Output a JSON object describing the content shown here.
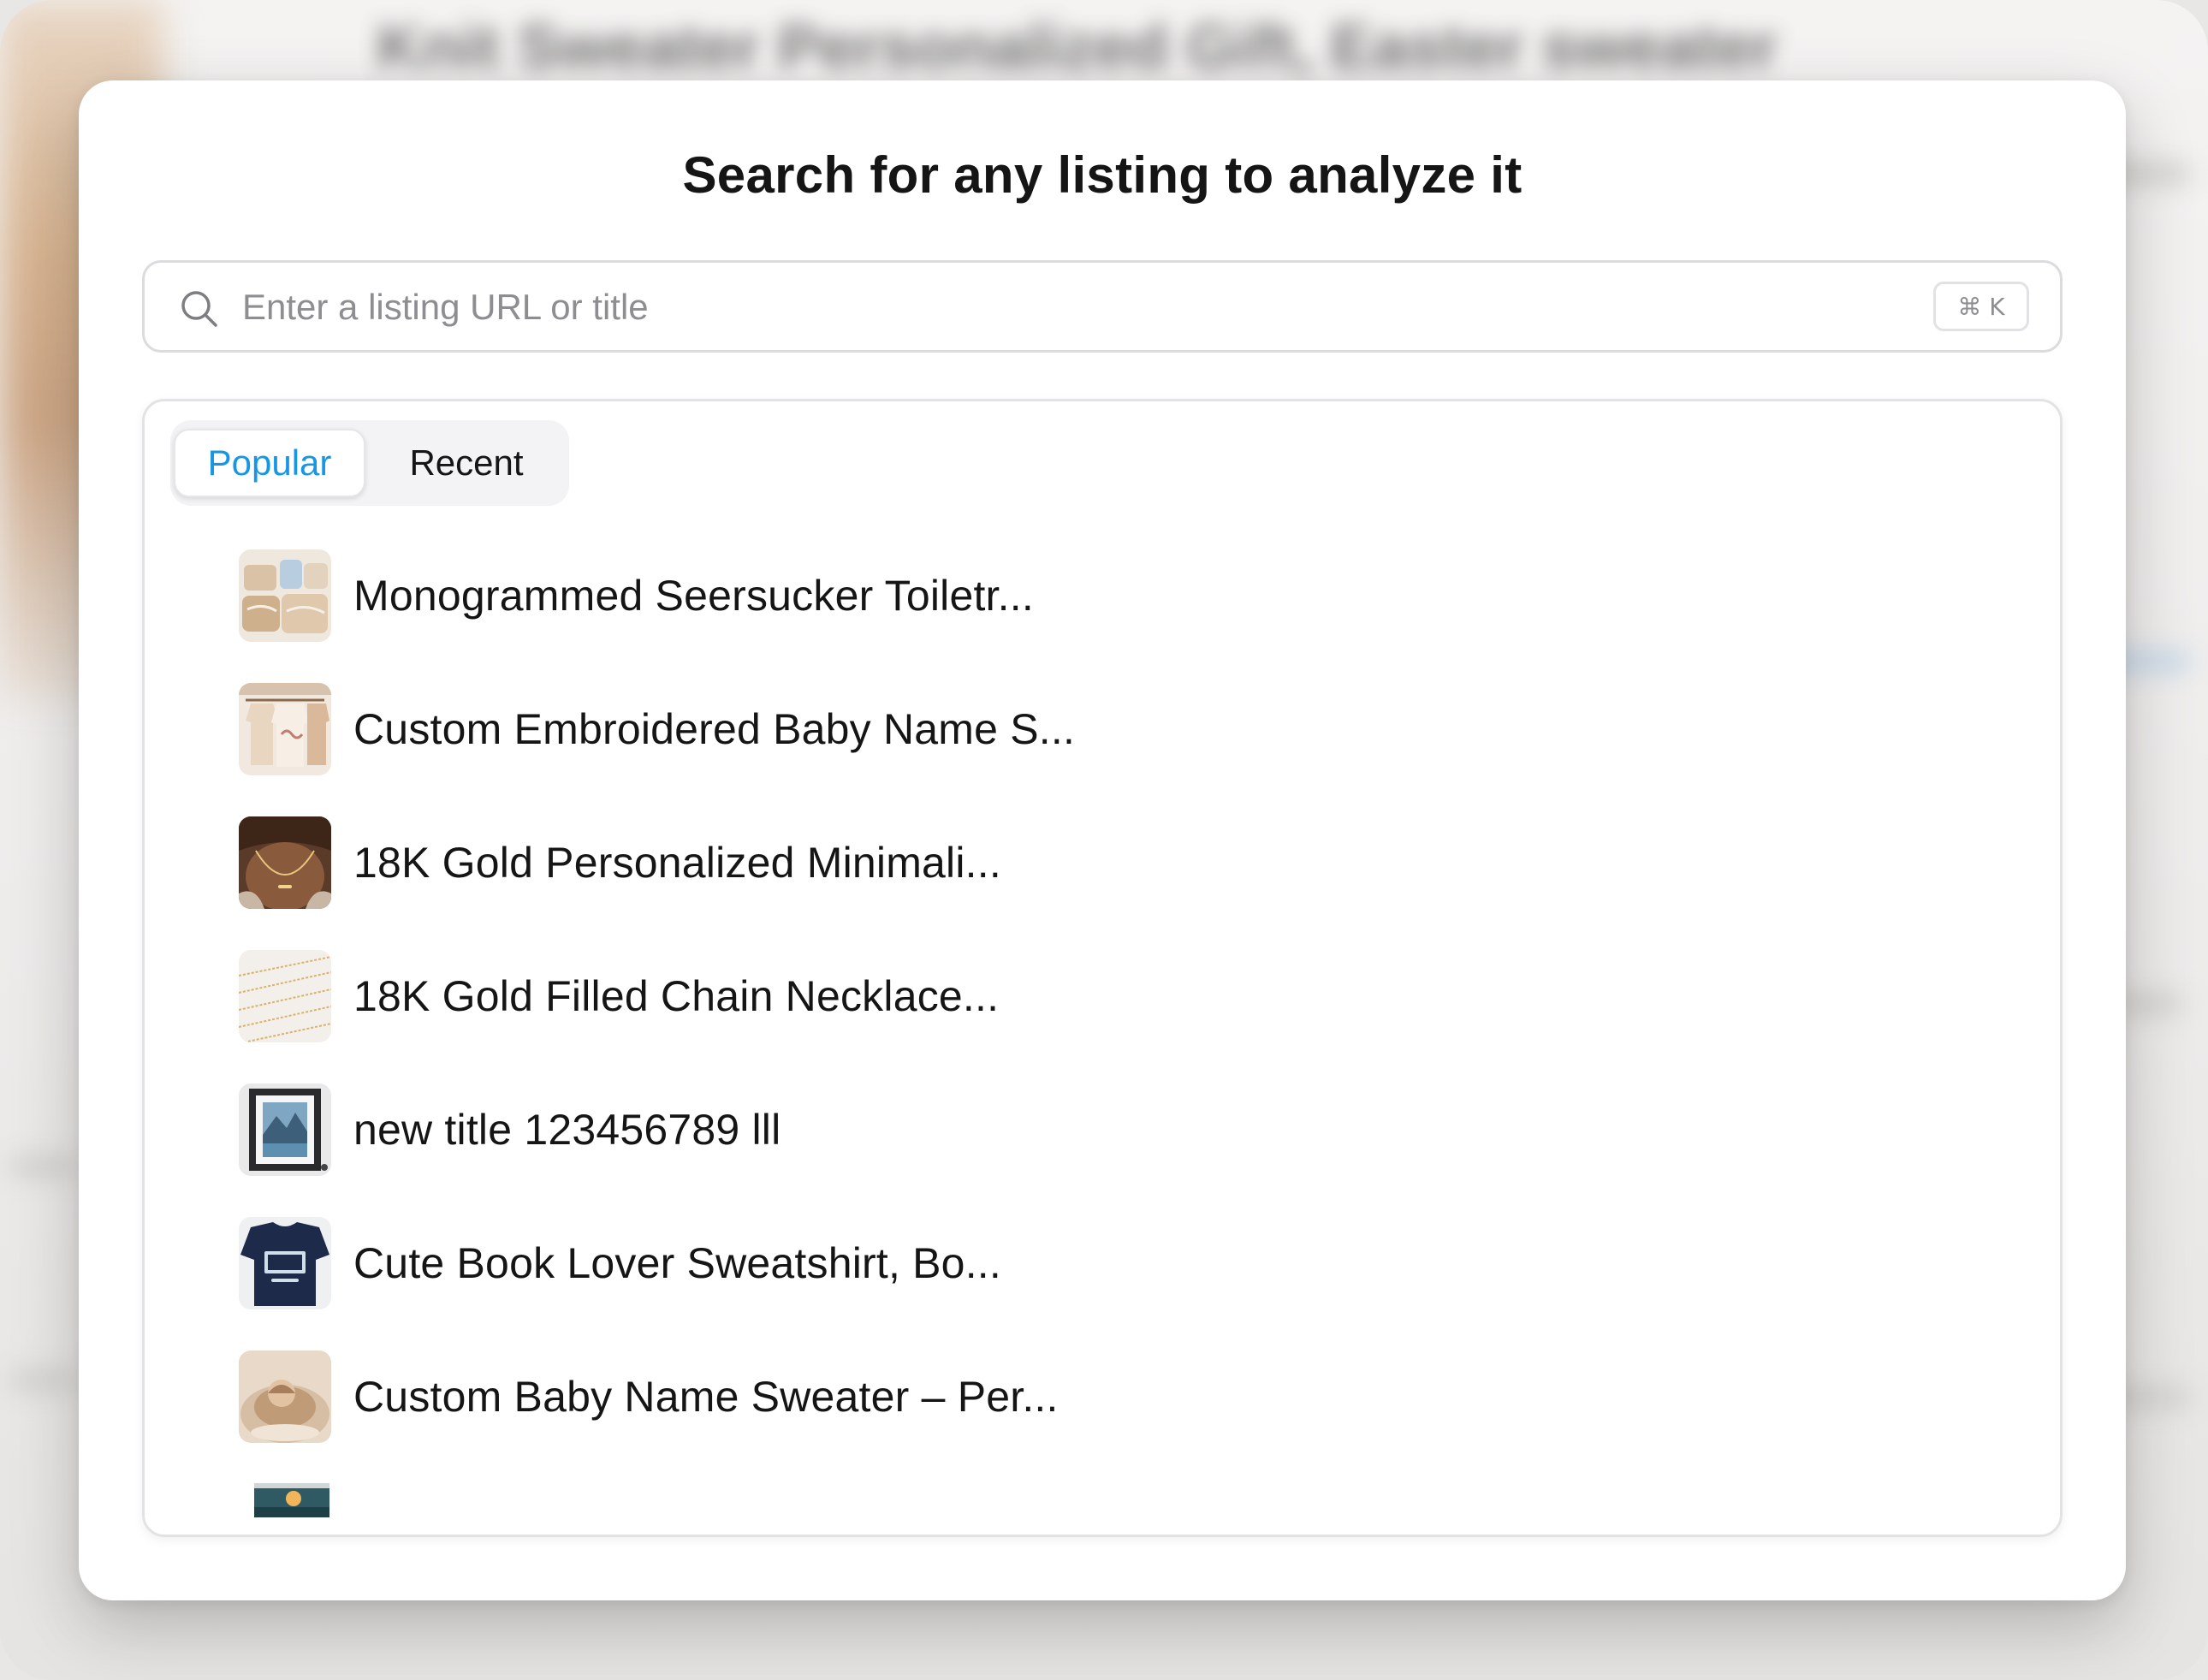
{
  "background": {
    "blurred_title": "Knit Sweater Personalized Gift, Easter sweater"
  },
  "modal": {
    "title": "Search for any listing to analyze it",
    "search": {
      "placeholder": "Enter a listing URL or title",
      "value": "",
      "shortcut": "⌘ K",
      "icon": "search-icon"
    },
    "tabs": [
      {
        "label": "Popular",
        "active": true
      },
      {
        "label": "Recent",
        "active": false
      }
    ],
    "listings": [
      {
        "title": "Monogrammed Seersucker Toiletr...",
        "thumbnail": "toiletry-bags-photo"
      },
      {
        "title": "Custom Embroidered Baby Name S...",
        "thumbnail": "baby-sweaters-rack-photo"
      },
      {
        "title": "18K Gold Personalized Minimali...",
        "thumbnail": "gold-necklace-on-neck-photo"
      },
      {
        "title": "18K Gold Filled Chain Necklace...",
        "thumbnail": "gold-chains-photo"
      },
      {
        "title": "new title 123456789 lll",
        "thumbnail": "framed-landscape-print-photo"
      },
      {
        "title": "Cute Book Lover Sweatshirt, Bo...",
        "thumbnail": "book-sweatshirt-photo"
      },
      {
        "title": "Custom Baby Name Sweater – Per...",
        "thumbnail": "baby-sleeping-photo"
      }
    ],
    "partial_listing_thumbnail": "landscape-print-photo"
  },
  "colors": {
    "accent": "#1697e6",
    "text": "#151515",
    "placeholder": "#8d8d92",
    "border": "#dcdcdf"
  }
}
